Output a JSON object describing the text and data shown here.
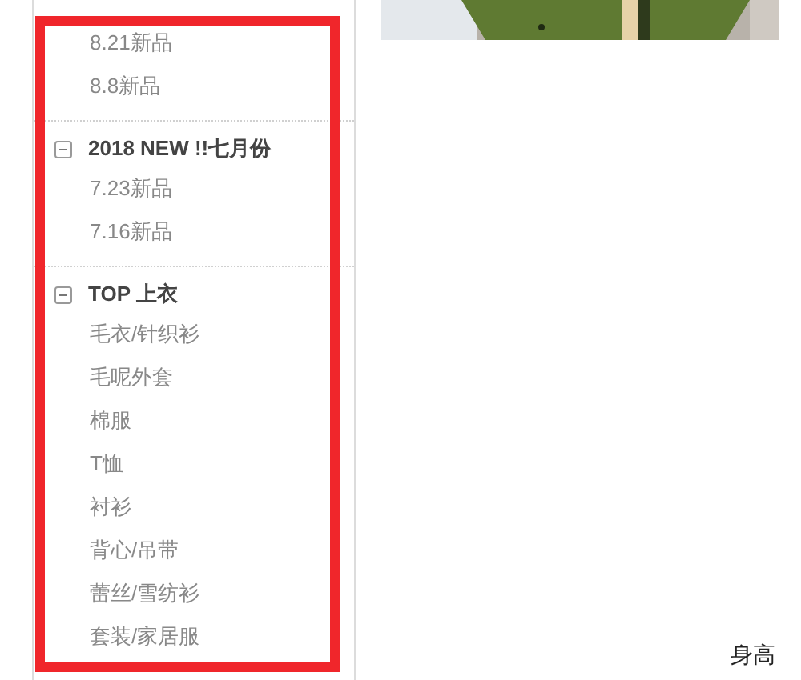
{
  "sidebar": {
    "groups": [
      {
        "items": [
          "8.21新品",
          "8.8新品"
        ]
      },
      {
        "title": "2018 NEW !!七月份",
        "expanded": true,
        "items": [
          "7.23新品",
          "7.16新品"
        ]
      },
      {
        "title": "TOP 上衣",
        "expanded": true,
        "items": [
          "毛衣/针织衫",
          "毛呢外套",
          "棉服",
          "T恤",
          "衬衫",
          "背心/吊带",
          "蕾丝/雪纺衫",
          "套装/家居服"
        ]
      }
    ]
  },
  "product": {
    "label": "身高"
  }
}
